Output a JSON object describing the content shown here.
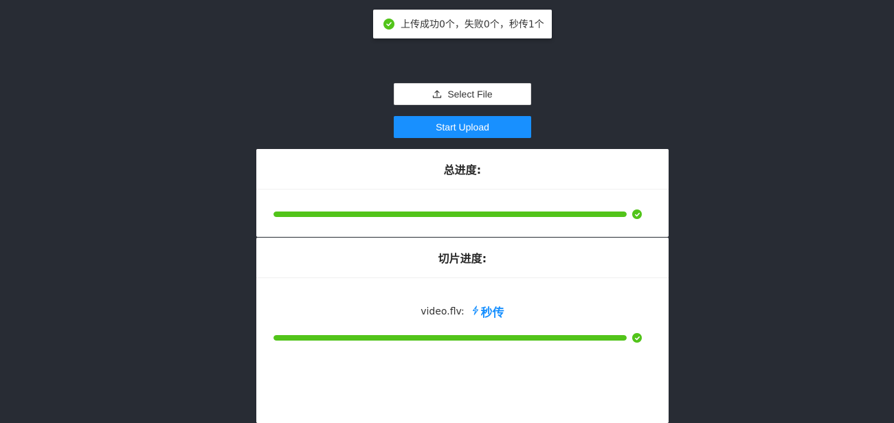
{
  "toast": {
    "message": "上传成功0个，失败0个，秒传1个",
    "icon": "check-circle-icon",
    "color": "#52c41a"
  },
  "buttons": {
    "select_file": "Select File",
    "select_file_icon": "upload-icon",
    "start_upload": "Start Upload"
  },
  "total_progress": {
    "title": "总进度:",
    "percent": 100,
    "status": "success"
  },
  "chunk_progress": {
    "title": "切片进度:",
    "file_name": "video.flv:",
    "instant_label": "秒传",
    "instant_icon": "lightning-icon",
    "percent": 100,
    "status": "success"
  },
  "colors": {
    "background": "#282c34",
    "primary": "#1890ff",
    "success": "#52c41a"
  }
}
